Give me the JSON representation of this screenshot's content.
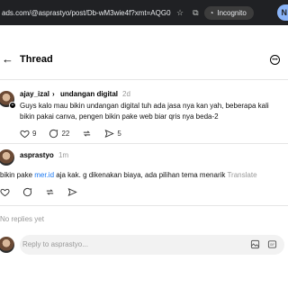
{
  "browser": {
    "url": "ads.com/@asprastyo/post/Db-wM3wie4f?xmt=AQG0...",
    "incognito_label": "Incognito",
    "profile_initial": "N"
  },
  "header": {
    "title": "Thread",
    "back_icon": "arrow-left-icon",
    "more_icon": "more-circle-icon"
  },
  "original_post": {
    "username": "ajay_izal",
    "separator": "›",
    "community": "undangan digital",
    "time": "2d",
    "text_line1": "Guys kalo mau bikin undangan digital tuh ada jasa nya kan yah, beberapa kali",
    "text_line2": "bikin pakai canva, pengen bikin pake web biar qris nya beda-2",
    "likes": "9",
    "replies": "22",
    "shares": "5"
  },
  "reply_post": {
    "username": "asprastyo",
    "time": "1m",
    "text_before_link": "bikin pake ",
    "link": "mer.id",
    "text_after_link": " aja kak. g dikenakan biaya, ada pilihan tema menarik",
    "translate": "Translate"
  },
  "no_replies": "No replies yet",
  "reply_box": {
    "placeholder": "Reply to asprastyo..."
  }
}
